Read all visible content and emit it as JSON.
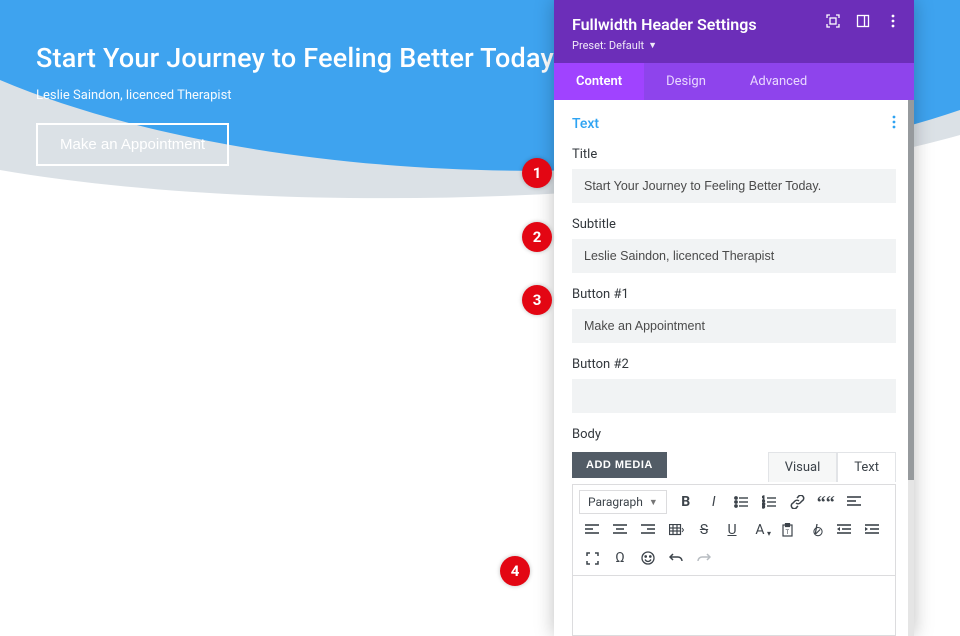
{
  "hero": {
    "title": "Start Your Journey to Feeling Better Today.",
    "subtitle": "Leslie Saindon, licenced Therapist",
    "button": "Make an Appointment"
  },
  "panel": {
    "title": "Fullwidth Header Settings",
    "preset": "Preset: Default",
    "tabs": {
      "content": "Content",
      "design": "Design",
      "advanced": "Advanced"
    },
    "section_text": "Text",
    "fields": {
      "title_label": "Title",
      "title_value": "Start Your Journey to Feeling Better Today.",
      "subtitle_label": "Subtitle",
      "subtitle_value": "Leslie Saindon, licenced Therapist",
      "button1_label": "Button #1",
      "button1_value": "Make an Appointment",
      "button2_label": "Button #2",
      "button2_value": "",
      "body_label": "Body"
    },
    "editor": {
      "add_media": "ADD MEDIA",
      "tab_visual": "Visual",
      "tab_text": "Text",
      "paragraph": "Paragraph"
    }
  },
  "badges": {
    "b1": "1",
    "b2": "2",
    "b3": "3",
    "b4": "4"
  }
}
